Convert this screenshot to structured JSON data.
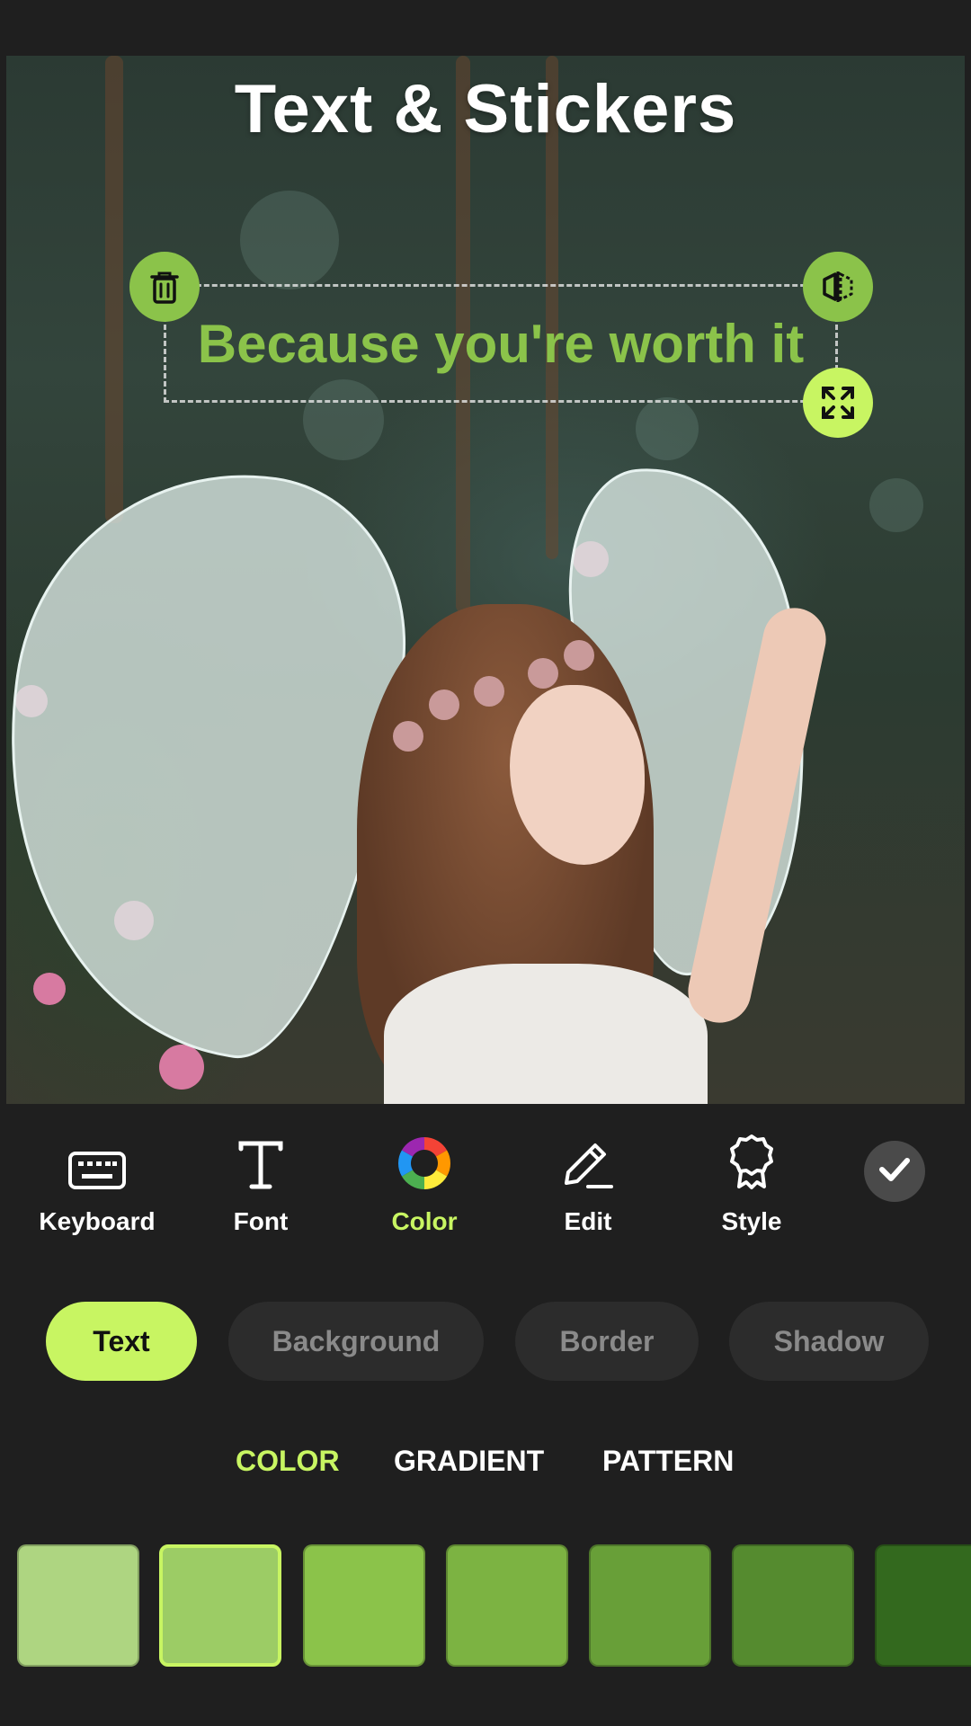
{
  "header": {
    "title": "Text & Stickers"
  },
  "canvas": {
    "overlay_text": "Because you're worth it",
    "overlay_text_color": "#8bc34a"
  },
  "handles": {
    "delete": "trash-icon",
    "flip": "flip-icon",
    "scale": "expand-icon"
  },
  "toolbar": {
    "items": [
      {
        "label": "Keyboard",
        "icon": "keyboard-icon"
      },
      {
        "label": "Font",
        "icon": "font-icon"
      },
      {
        "label": "Color",
        "icon": "color-wheel-icon",
        "active": true
      },
      {
        "label": "Edit",
        "icon": "pencil-icon"
      },
      {
        "label": "Style",
        "icon": "badge-icon"
      }
    ],
    "confirm_icon": "check-icon"
  },
  "target_tabs": [
    {
      "label": "Text",
      "active": true
    },
    {
      "label": "Background"
    },
    {
      "label": "Border"
    },
    {
      "label": "Shadow"
    }
  ],
  "fill_tabs": [
    {
      "label": "COLOR",
      "active": true
    },
    {
      "label": "GRADIENT"
    },
    {
      "label": "PATTERN"
    }
  ],
  "swatches": [
    {
      "color": "#aed581"
    },
    {
      "color": "#9ccc65",
      "selected": true
    },
    {
      "color": "#8bc34a"
    },
    {
      "color": "#7cb342"
    },
    {
      "color": "#689f38"
    },
    {
      "color": "#558b2f"
    },
    {
      "color": "#33691e"
    }
  ],
  "theme": {
    "accent": "#c8f562",
    "background": "#1f1f1f"
  }
}
